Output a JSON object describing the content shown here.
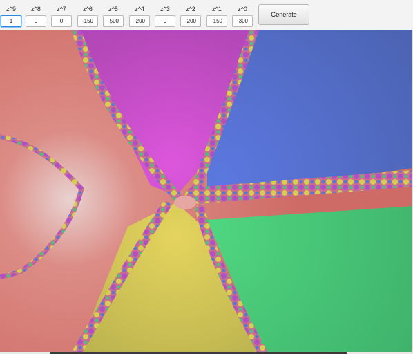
{
  "toolbar": {
    "coefficients": [
      {
        "label": "z^9",
        "value": "1"
      },
      {
        "label": "z^8",
        "value": "0"
      },
      {
        "label": "z^7",
        "value": "0"
      },
      {
        "label": "z^6",
        "value": "-150"
      },
      {
        "label": "z^5",
        "value": "-500"
      },
      {
        "label": "z^4",
        "value": "-200"
      },
      {
        "label": "z^3",
        "value": "0"
      },
      {
        "label": "z^2",
        "value": "-200"
      },
      {
        "label": "z^1",
        "value": "-150"
      },
      {
        "label": "z^0",
        "value": "-300"
      }
    ],
    "generate_label": "Generate"
  },
  "fractal": {
    "colors": {
      "pink": "#d9736f",
      "purple": "#c451c4",
      "blue": "#5a6fcb",
      "green": "#48c77a",
      "yellow": "#cfc45a",
      "boundary": "#c46a8a"
    }
  }
}
